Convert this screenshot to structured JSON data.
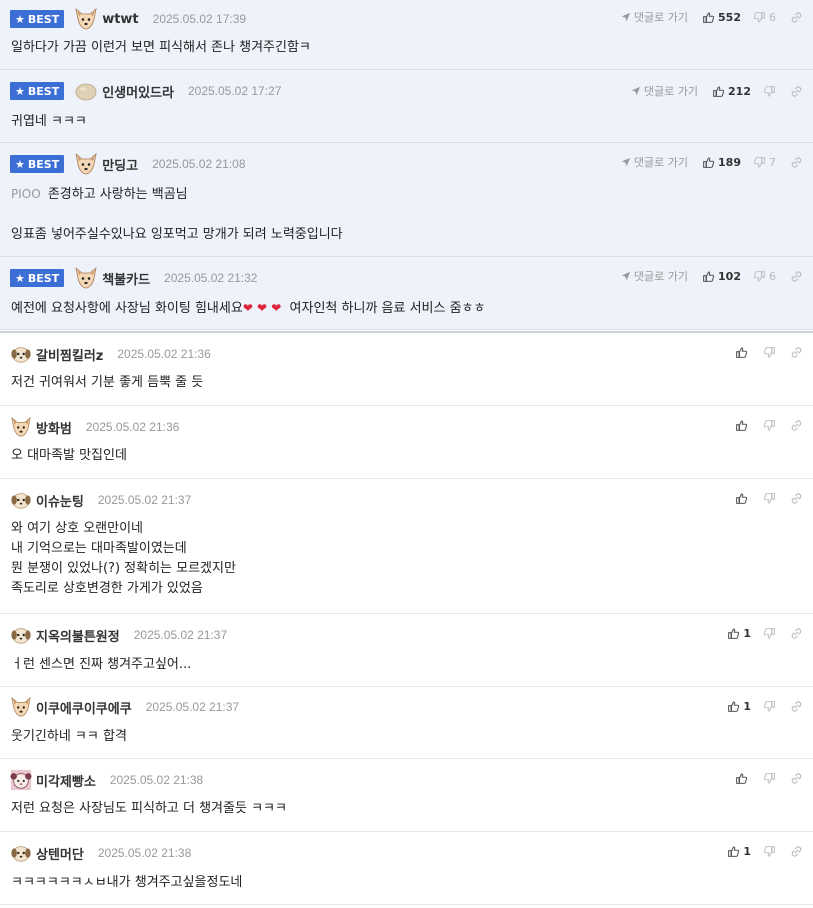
{
  "ui": {
    "best_label": "BEST",
    "goto_label": "댓글로 가기"
  },
  "comments": [
    {
      "best": true,
      "nick": "wtwt",
      "date": "2025.05.02 17:39",
      "likes": "552",
      "dislikes": "6",
      "text": "일하다가 가끔 이런거 보면 피식해서 존나 챙겨주긴함ㅋ"
    },
    {
      "best": true,
      "nick": "인생머있드라",
      "date": "2025.05.02 17:27",
      "likes": "212",
      "dislikes": "",
      "text": "귀엽네 ㅋㅋㅋ"
    },
    {
      "best": true,
      "nick": "만딩고",
      "date": "2025.05.02 21:08",
      "likes": "189",
      "dislikes": "7",
      "tag": "PIOO",
      "text": "존경하고 사랑하는 백곰님",
      "text2": "잉표좀 넣어주실수있나요 잉포먹고 망개가 되려 노력중입니다"
    },
    {
      "best": true,
      "nick": "책불카드",
      "date": "2025.05.02 21:32",
      "likes": "102",
      "dislikes": "6",
      "text_a": "예전에 요청사항에 사장님 화이팅 힘내세요",
      "text_b": "여자인척 하니까 음료 서비스 줌ㅎㅎ"
    },
    {
      "best": false,
      "nick": "갈비찜킬러z",
      "date": "2025.05.02 21:36",
      "likes": "",
      "text": "저건 귀여워서 기분 좋게 듬뿍 줄 듯"
    },
    {
      "best": false,
      "nick": "방화범",
      "date": "2025.05.02 21:36",
      "likes": "",
      "text": "오 대마족발 맛집인데"
    },
    {
      "best": false,
      "nick": "이슈눈팅",
      "date": "2025.05.02 21:37",
      "likes": "",
      "text": "와 여기 상호 오랜만이네\n내 기억으로는 대마족발이였는데\n뭔 분쟁이 있었나(?) 정확히는 모르겠지만\n족도리로 상호변경한 가게가 있었음"
    },
    {
      "best": false,
      "nick": "지옥의불튼원정",
      "date": "2025.05.02 21:37",
      "likes": "1",
      "text": "ㅓ런 센스면 진짜 챙겨주고싶어..."
    },
    {
      "best": false,
      "nick": "이쿠에쿠이쿠에쿠",
      "date": "2025.05.02 21:37",
      "likes": "1",
      "text": "웃기긴하네 ㅋㅋ 합격"
    },
    {
      "best": false,
      "nick": "미각제빵소",
      "date": "2025.05.02 21:38",
      "likes": "",
      "text": "저런 요청은 사장님도 피식하고 더 챙겨줄듯 ㅋㅋㅋ"
    },
    {
      "best": false,
      "nick": "상텐머단",
      "date": "2025.05.02 21:38",
      "likes": "1",
      "text": "ㅋㅋㅋㅋㅋㅋㅅㅂ내가 챙겨주고싶을정도네"
    }
  ],
  "icons": {
    "like": "thumbs-up-icon",
    "dislike": "thumbs-down-icon",
    "link": "link-icon",
    "goto": "navigation-arrow-icon",
    "best_star": "star-icon",
    "avatar_dog": "dog-avatar-icon",
    "avatar_blob": "blob-avatar-icon",
    "avatar_face": "face-avatar-icon"
  },
  "colors": {
    "best_bg": "#eef2fb",
    "best_badge": "#3c6fd6",
    "heart": "#e0243a"
  }
}
